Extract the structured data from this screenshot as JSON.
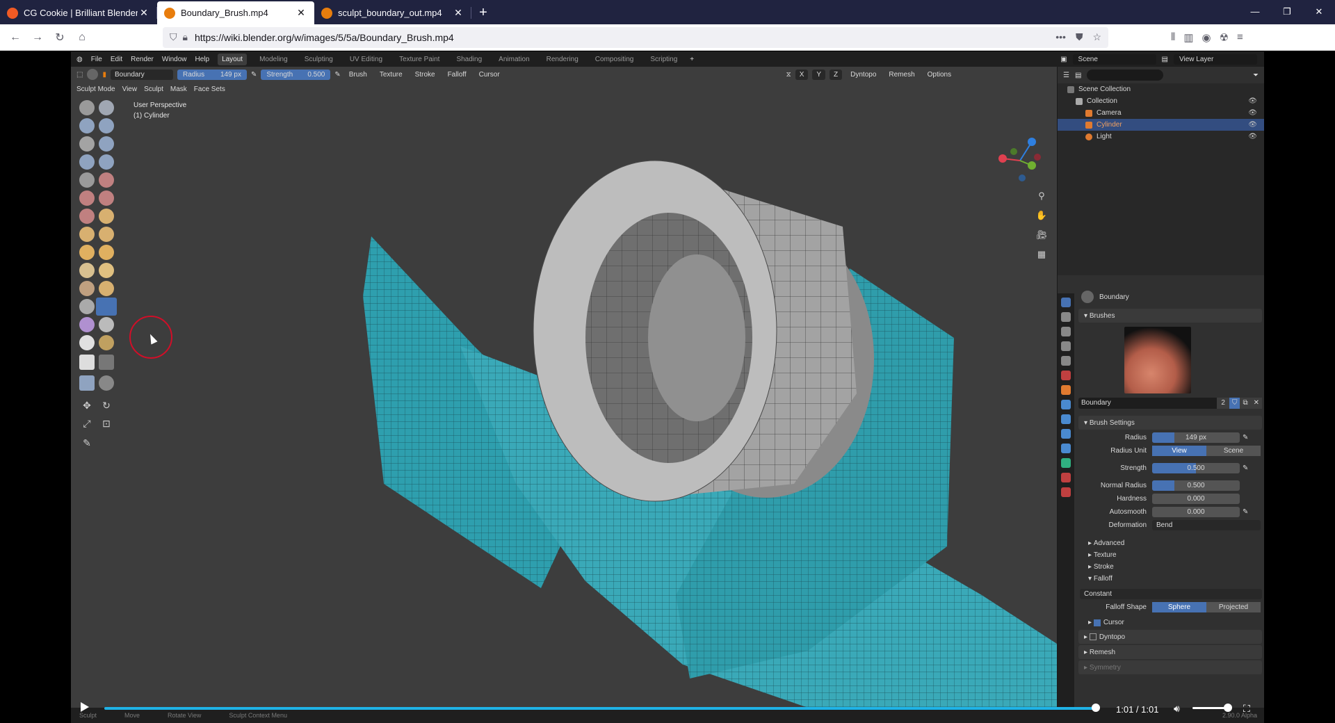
{
  "browser": {
    "tabs": [
      {
        "title": "CG Cookie | Brilliant Blender, U",
        "active": false,
        "favicon_color": "#f15a24"
      },
      {
        "title": "Boundary_Brush.mp4",
        "active": true,
        "favicon_color": "#e87d0d"
      },
      {
        "title": "sculpt_boundary_out.mp4",
        "active": false,
        "favicon_color": "#e87d0d"
      }
    ],
    "new_tab": "+",
    "url": "https://wiki.blender.org/w/images/5/5a/Boundary_Brush.mp4"
  },
  "blender": {
    "menus": [
      "File",
      "Edit",
      "Render",
      "Window",
      "Help"
    ],
    "workspaces": [
      "Layout",
      "Modeling",
      "Sculpting",
      "UV Editing",
      "Texture Paint",
      "Shading",
      "Animation",
      "Rendering",
      "Compositing",
      "Scripting"
    ],
    "active_workspace": "Layout",
    "scene": "Scene",
    "view_layer": "View Layer",
    "header": {
      "brush_name": "Boundary",
      "radius_label": "Radius",
      "radius_value": "149 px",
      "strength_label": "Strength",
      "strength_value": "0.500",
      "dropdowns": [
        "Brush",
        "Texture",
        "Stroke",
        "Falloff",
        "Cursor"
      ],
      "axes": [
        "X",
        "Y",
        "Z"
      ],
      "right_dropdowns": [
        "Dyntopo",
        "Remesh",
        "Options"
      ]
    },
    "header2": {
      "mode": "Sculpt Mode",
      "menus": [
        "View",
        "Sculpt",
        "Mask",
        "Face Sets"
      ]
    },
    "viewport_info": {
      "perspective": "User Perspective",
      "object": "(1) Cylinder"
    },
    "outliner": {
      "root": "Scene Collection",
      "collection": "Collection",
      "items": [
        {
          "name": "Camera",
          "selected": false,
          "color": "#e07a30"
        },
        {
          "name": "Cylinder",
          "selected": true,
          "color": "#e07a30"
        },
        {
          "name": "Light",
          "selected": false,
          "color": "#e07a30"
        }
      ]
    },
    "properties": {
      "brush_header": "Boundary",
      "brushes_panel": "Brushes",
      "brush_field": "Boundary",
      "brush_users": "2",
      "brush_settings_panel": "Brush Settings",
      "radius_label": "Radius",
      "radius_value": "149 px",
      "radius_unit_label": "Radius Unit",
      "radius_unit_options": [
        "View",
        "Scene"
      ],
      "strength_label": "Strength",
      "strength_value": "0.500",
      "normal_radius_label": "Normal Radius",
      "normal_radius_value": "0.500",
      "hardness_label": "Hardness",
      "hardness_value": "0.000",
      "autosmooth_label": "Autosmooth",
      "autosmooth_value": "0.000",
      "deformation_label": "Deformation",
      "deformation_value": "Bend",
      "subpanels": [
        "Advanced",
        "Texture",
        "Stroke"
      ],
      "falloff_label": "Falloff",
      "falloff_value": "Constant",
      "falloff_shape_label": "Falloff Shape",
      "falloff_shape_options": [
        "Sphere",
        "Projected"
      ],
      "cursor_label": "Cursor",
      "dyntopo_label": "Dyntopo",
      "remesh_label": "Remesh",
      "symmetry_label": "Symmetry",
      "version": "2.90.0 Alpha"
    },
    "status": {
      "items": [
        "Sculpt",
        "Move",
        "Rotate View",
        "Sculpt Context Menu"
      ]
    }
  },
  "video": {
    "time": "1:01 / 1:01",
    "progress": 0.99
  }
}
